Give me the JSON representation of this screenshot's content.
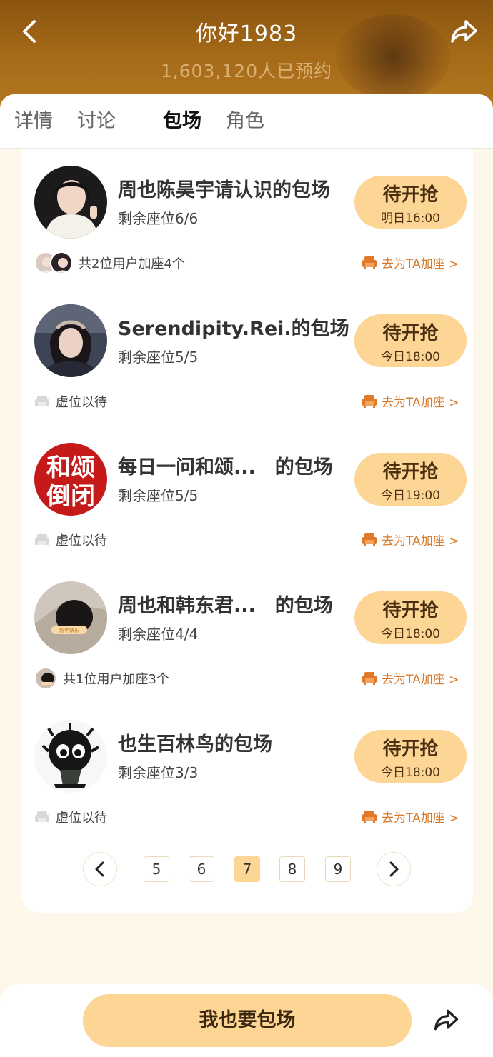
{
  "header": {
    "title": "你好1983",
    "subtitle": "1,603,120人已预约"
  },
  "tabs": [
    {
      "label": "详情",
      "active": false
    },
    {
      "label": "讨论",
      "active": false
    },
    {
      "label": "包场",
      "active": true
    },
    {
      "label": "角色",
      "active": false
    }
  ],
  "items": [
    {
      "name": "周也陈昊宇请认识的包场",
      "seats": "剩余座位6/6",
      "btn_main": "待开抢",
      "btn_time": "明日16:00",
      "footer": "共2位用户加座4个",
      "footer_type": "users",
      "add_label": "去为TA加座 >"
    },
    {
      "name": "Serendipity.Rei.的包场",
      "seats": "剩余座位5/5",
      "btn_main": "待开抢",
      "btn_time": "今日18:00",
      "footer": "虚位以待",
      "footer_type": "empty",
      "add_label": "去为TA加座 >"
    },
    {
      "name": "每日一问和颂...　的包场",
      "seats": "剩余座位5/5",
      "btn_main": "待开抢",
      "btn_time": "今日19:00",
      "footer": "虚位以待",
      "footer_type": "empty",
      "add_label": "去为TA加座 >",
      "avatar_text": "和颂\n倒闭"
    },
    {
      "name": "周也和韩东君...　的包场",
      "seats": "剩余座位4/4",
      "btn_main": "待开抢",
      "btn_time": "今日18:00",
      "footer": "共1位用户加座3个",
      "footer_type": "users",
      "add_label": "去为TA加座 >"
    },
    {
      "name": "也生百林鸟的包场",
      "seats": "剩余座位3/3",
      "btn_main": "待开抢",
      "btn_time": "今日18:00",
      "footer": "虚位以待",
      "footer_type": "empty",
      "add_label": "去为TA加座 >"
    }
  ],
  "pagination": {
    "pages": [
      "5",
      "6",
      "7",
      "8",
      "9"
    ],
    "current": "7"
  },
  "bottom": {
    "cta": "我也要包场"
  },
  "colors": {
    "accent": "#fdd594",
    "link": "#d87a2c",
    "header": "#a56a18"
  }
}
